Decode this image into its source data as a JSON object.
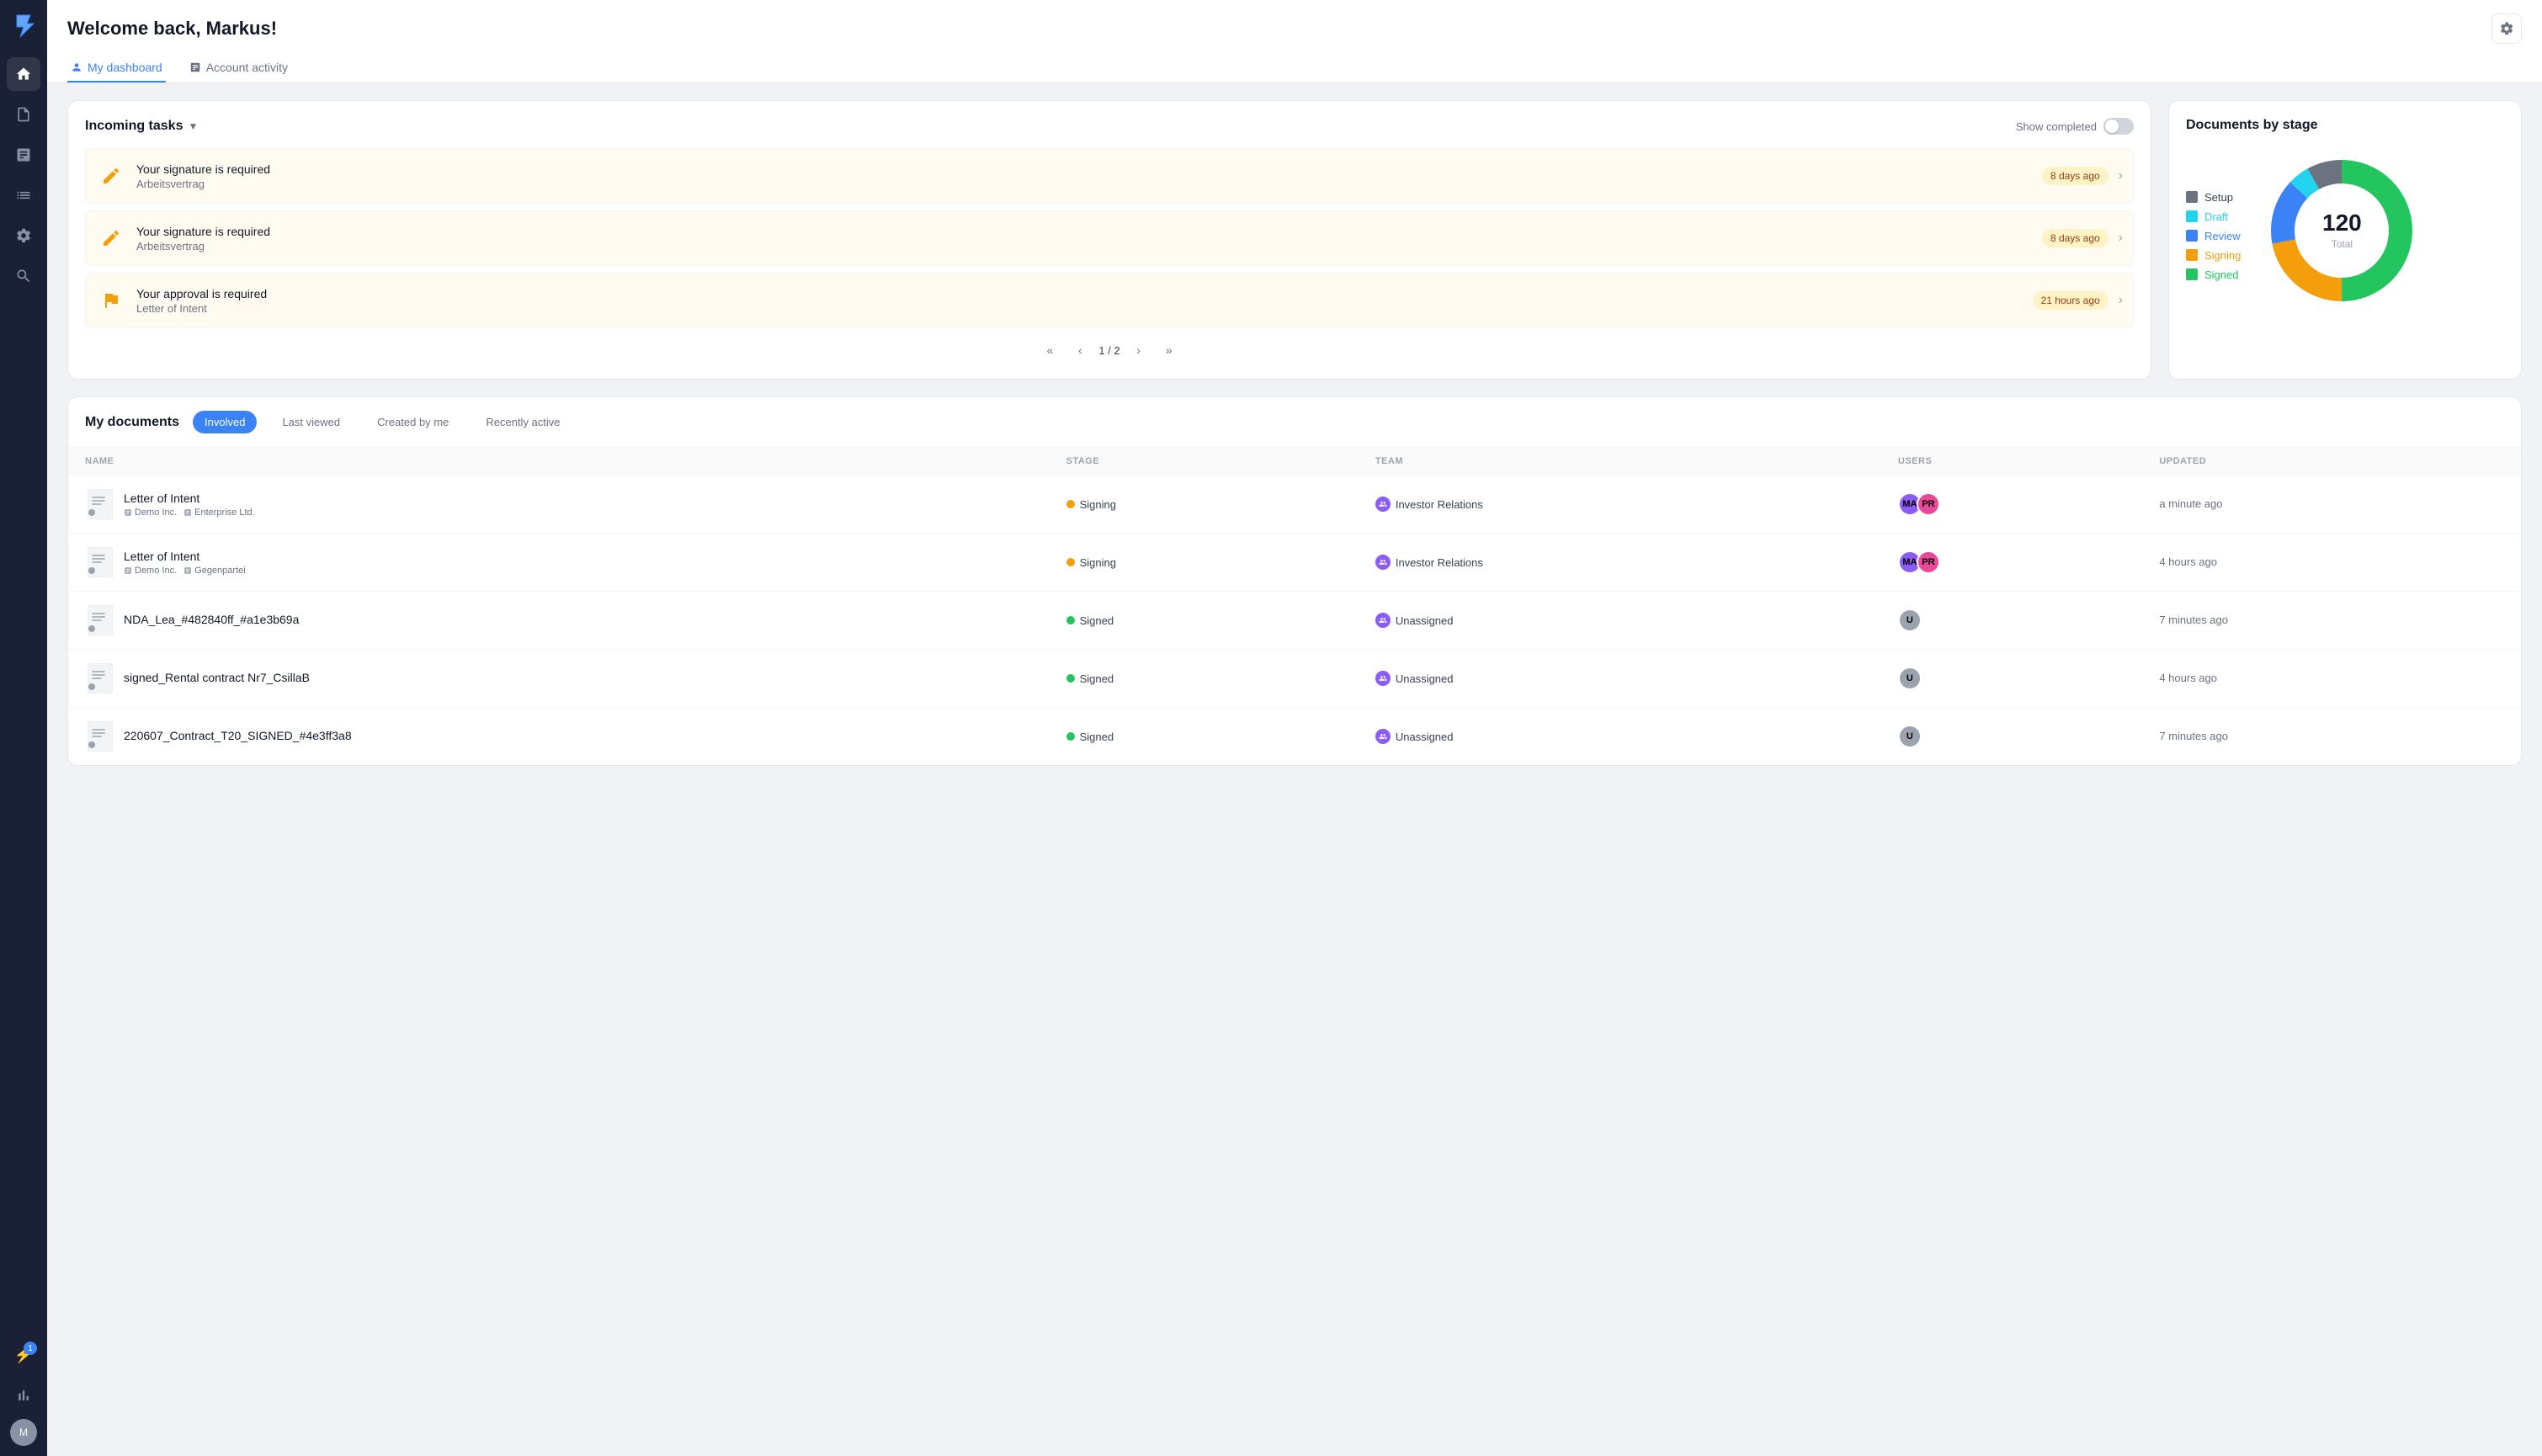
{
  "app": {
    "logo": "⚡",
    "title": "Welcome back, Markus!"
  },
  "header": {
    "tabs": [
      {
        "id": "my-dashboard",
        "label": "My dashboard",
        "active": true
      },
      {
        "id": "account-activity",
        "label": "Account activity",
        "active": false
      }
    ],
    "gear_label": "Settings"
  },
  "sidebar": {
    "items": [
      {
        "id": "home",
        "icon": "⊞",
        "active": true
      },
      {
        "id": "docs",
        "icon": "📄",
        "active": false
      },
      {
        "id": "templates",
        "icon": "📋",
        "active": false
      },
      {
        "id": "list",
        "icon": "☰",
        "active": false
      },
      {
        "id": "settings",
        "icon": "⚙",
        "active": false
      },
      {
        "id": "search",
        "icon": "🔍",
        "active": false
      }
    ],
    "bottom": [
      {
        "id": "notifications",
        "icon": "⚡",
        "badge": "1"
      },
      {
        "id": "analytics",
        "icon": "📊"
      },
      {
        "id": "avatar",
        "label": "M"
      }
    ]
  },
  "tasks": {
    "title": "Incoming tasks",
    "show_completed_label": "Show completed",
    "items": [
      {
        "icon": "✍",
        "title": "Your signature is required",
        "subtitle": "Arbeitsvertrag",
        "badge": "8 days ago"
      },
      {
        "icon": "✍",
        "title": "Your signature is required",
        "subtitle": "Arbeitsvertrag",
        "badge": "8 days ago"
      },
      {
        "icon": "🏳",
        "title": "Your approval is required",
        "subtitle": "Letter of Intent",
        "badge": "21 hours ago"
      }
    ],
    "pagination": {
      "current": "1",
      "total": "2",
      "display": "1 / 2"
    }
  },
  "donut_chart": {
    "title": "Documents by stage",
    "total": "120",
    "total_label": "Total",
    "legend": [
      {
        "id": "setup",
        "label": "Setup",
        "color": "#6b7280",
        "value": 8
      },
      {
        "id": "draft",
        "label": "Draft",
        "color": "#22d3ee",
        "value": 5
      },
      {
        "id": "review",
        "label": "Review",
        "color": "#3b82f6",
        "value": 15
      },
      {
        "id": "signing",
        "label": "Signing",
        "color": "#f59e0b",
        "value": 22
      },
      {
        "id": "signed",
        "label": "Signed",
        "color": "#22c55e",
        "value": 50
      }
    ]
  },
  "documents": {
    "title": "My documents",
    "tabs": [
      {
        "id": "involved",
        "label": "Involved",
        "active": true
      },
      {
        "id": "last-viewed",
        "label": "Last viewed",
        "active": false
      },
      {
        "id": "created-by-me",
        "label": "Created by me",
        "active": false
      },
      {
        "id": "recently-active",
        "label": "Recently active",
        "active": false
      }
    ],
    "columns": [
      {
        "id": "name",
        "label": "NAME"
      },
      {
        "id": "stage",
        "label": "STAGE"
      },
      {
        "id": "team",
        "label": "TEAM"
      },
      {
        "id": "users",
        "label": "USERS"
      },
      {
        "id": "updated",
        "label": "UPDATED"
      }
    ],
    "rows": [
      {
        "id": 1,
        "name": "Letter of Intent",
        "parties": [
          "Demo Inc.",
          "Enterprise Ltd."
        ],
        "stage": "Signing",
        "stage_color": "#f59e0b",
        "team": "Investor Relations",
        "users": [
          "MA",
          "PR"
        ],
        "user_colors": [
          "#8b5cf6",
          "#ec4899"
        ],
        "updated": "a minute ago"
      },
      {
        "id": 2,
        "name": "Letter of Intent",
        "parties": [
          "Demo Inc.",
          "Gegenpartei"
        ],
        "stage": "Signing",
        "stage_color": "#f59e0b",
        "team": "Investor Relations",
        "users": [
          "MA",
          "PR"
        ],
        "user_colors": [
          "#8b5cf6",
          "#ec4899"
        ],
        "updated": "4 hours ago"
      },
      {
        "id": 3,
        "name": "NDA_Lea_#482840ff_#a1e3b69a",
        "parties": [],
        "stage": "Signed",
        "stage_color": "#22c55e",
        "team": "Unassigned",
        "users": [
          "U"
        ],
        "user_colors": [
          "#9ca3af"
        ],
        "updated": "7 minutes ago"
      },
      {
        "id": 4,
        "name": "signed_Rental contract Nr7_CsillaB",
        "parties": [],
        "stage": "Signed",
        "stage_color": "#22c55e",
        "team": "Unassigned",
        "users": [
          "U"
        ],
        "user_colors": [
          "#9ca3af"
        ],
        "updated": "4 hours ago"
      },
      {
        "id": 5,
        "name": "220607_Contract_T20_SIGNED_#4e3ff3a8",
        "parties": [],
        "stage": "Signed",
        "stage_color": "#22c55e",
        "team": "Unassigned",
        "users": [
          "U"
        ],
        "user_colors": [
          "#9ca3af"
        ],
        "updated": "7 minutes ago"
      }
    ]
  }
}
